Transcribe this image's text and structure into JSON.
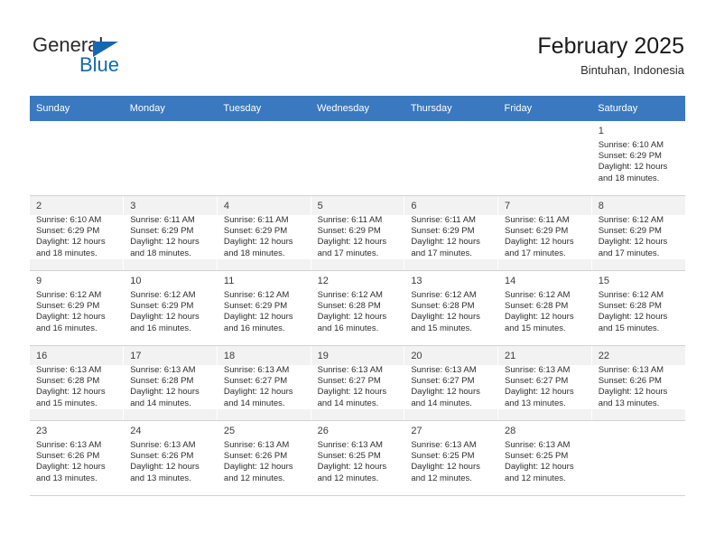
{
  "brand": {
    "line1": "General",
    "line2": "Blue",
    "triangle_color": "#1268b3",
    "icon": "triangle-icon"
  },
  "header": {
    "title": "February 2025",
    "subtitle": "Bintuhan, Indonesia"
  },
  "theme": {
    "header_row_bg": "#3a78bf",
    "header_row_text": "#ffffff",
    "band_shaded_bg": "#f2f2f2",
    "cell_bg": "#ffffff",
    "grid_line": "#d2d2d2"
  },
  "weekdays": [
    "Sunday",
    "Monday",
    "Tuesday",
    "Wednesday",
    "Thursday",
    "Friday",
    "Saturday"
  ],
  "labels": {
    "sunrise": "Sunrise:",
    "sunset": "Sunset:",
    "daylight": "Daylight:"
  },
  "weeks": [
    {
      "shaded": false,
      "days": [
        {
          "num": "",
          "lines": []
        },
        {
          "num": "",
          "lines": []
        },
        {
          "num": "",
          "lines": []
        },
        {
          "num": "",
          "lines": []
        },
        {
          "num": "",
          "lines": []
        },
        {
          "num": "",
          "lines": []
        },
        {
          "num": "1",
          "lines": [
            "Sunrise: 6:10 AM",
            "Sunset: 6:29 PM",
            "Daylight: 12 hours",
            "and 18 minutes."
          ]
        }
      ]
    },
    {
      "shaded": true,
      "days": [
        {
          "num": "2",
          "lines": [
            "Sunrise: 6:10 AM",
            "Sunset: 6:29 PM",
            "Daylight: 12 hours",
            "and 18 minutes."
          ]
        },
        {
          "num": "3",
          "lines": [
            "Sunrise: 6:11 AM",
            "Sunset: 6:29 PM",
            "Daylight: 12 hours",
            "and 18 minutes."
          ]
        },
        {
          "num": "4",
          "lines": [
            "Sunrise: 6:11 AM",
            "Sunset: 6:29 PM",
            "Daylight: 12 hours",
            "and 18 minutes."
          ]
        },
        {
          "num": "5",
          "lines": [
            "Sunrise: 6:11 AM",
            "Sunset: 6:29 PM",
            "Daylight: 12 hours",
            "and 17 minutes."
          ]
        },
        {
          "num": "6",
          "lines": [
            "Sunrise: 6:11 AM",
            "Sunset: 6:29 PM",
            "Daylight: 12 hours",
            "and 17 minutes."
          ]
        },
        {
          "num": "7",
          "lines": [
            "Sunrise: 6:11 AM",
            "Sunset: 6:29 PM",
            "Daylight: 12 hours",
            "and 17 minutes."
          ]
        },
        {
          "num": "8",
          "lines": [
            "Sunrise: 6:12 AM",
            "Sunset: 6:29 PM",
            "Daylight: 12 hours",
            "and 17 minutes."
          ]
        }
      ]
    },
    {
      "shaded": false,
      "days": [
        {
          "num": "9",
          "lines": [
            "Sunrise: 6:12 AM",
            "Sunset: 6:29 PM",
            "Daylight: 12 hours",
            "and 16 minutes."
          ]
        },
        {
          "num": "10",
          "lines": [
            "Sunrise: 6:12 AM",
            "Sunset: 6:29 PM",
            "Daylight: 12 hours",
            "and 16 minutes."
          ]
        },
        {
          "num": "11",
          "lines": [
            "Sunrise: 6:12 AM",
            "Sunset: 6:29 PM",
            "Daylight: 12 hours",
            "and 16 minutes."
          ]
        },
        {
          "num": "12",
          "lines": [
            "Sunrise: 6:12 AM",
            "Sunset: 6:28 PM",
            "Daylight: 12 hours",
            "and 16 minutes."
          ]
        },
        {
          "num": "13",
          "lines": [
            "Sunrise: 6:12 AM",
            "Sunset: 6:28 PM",
            "Daylight: 12 hours",
            "and 15 minutes."
          ]
        },
        {
          "num": "14",
          "lines": [
            "Sunrise: 6:12 AM",
            "Sunset: 6:28 PM",
            "Daylight: 12 hours",
            "and 15 minutes."
          ]
        },
        {
          "num": "15",
          "lines": [
            "Sunrise: 6:12 AM",
            "Sunset: 6:28 PM",
            "Daylight: 12 hours",
            "and 15 minutes."
          ]
        }
      ]
    },
    {
      "shaded": true,
      "days": [
        {
          "num": "16",
          "lines": [
            "Sunrise: 6:13 AM",
            "Sunset: 6:28 PM",
            "Daylight: 12 hours",
            "and 15 minutes."
          ]
        },
        {
          "num": "17",
          "lines": [
            "Sunrise: 6:13 AM",
            "Sunset: 6:28 PM",
            "Daylight: 12 hours",
            "and 14 minutes."
          ]
        },
        {
          "num": "18",
          "lines": [
            "Sunrise: 6:13 AM",
            "Sunset: 6:27 PM",
            "Daylight: 12 hours",
            "and 14 minutes."
          ]
        },
        {
          "num": "19",
          "lines": [
            "Sunrise: 6:13 AM",
            "Sunset: 6:27 PM",
            "Daylight: 12 hours",
            "and 14 minutes."
          ]
        },
        {
          "num": "20",
          "lines": [
            "Sunrise: 6:13 AM",
            "Sunset: 6:27 PM",
            "Daylight: 12 hours",
            "and 14 minutes."
          ]
        },
        {
          "num": "21",
          "lines": [
            "Sunrise: 6:13 AM",
            "Sunset: 6:27 PM",
            "Daylight: 12 hours",
            "and 13 minutes."
          ]
        },
        {
          "num": "22",
          "lines": [
            "Sunrise: 6:13 AM",
            "Sunset: 6:26 PM",
            "Daylight: 12 hours",
            "and 13 minutes."
          ]
        }
      ]
    },
    {
      "shaded": false,
      "days": [
        {
          "num": "23",
          "lines": [
            "Sunrise: 6:13 AM",
            "Sunset: 6:26 PM",
            "Daylight: 12 hours",
            "and 13 minutes."
          ]
        },
        {
          "num": "24",
          "lines": [
            "Sunrise: 6:13 AM",
            "Sunset: 6:26 PM",
            "Daylight: 12 hours",
            "and 13 minutes."
          ]
        },
        {
          "num": "25",
          "lines": [
            "Sunrise: 6:13 AM",
            "Sunset: 6:26 PM",
            "Daylight: 12 hours",
            "and 12 minutes."
          ]
        },
        {
          "num": "26",
          "lines": [
            "Sunrise: 6:13 AM",
            "Sunset: 6:25 PM",
            "Daylight: 12 hours",
            "and 12 minutes."
          ]
        },
        {
          "num": "27",
          "lines": [
            "Sunrise: 6:13 AM",
            "Sunset: 6:25 PM",
            "Daylight: 12 hours",
            "and 12 minutes."
          ]
        },
        {
          "num": "28",
          "lines": [
            "Sunrise: 6:13 AM",
            "Sunset: 6:25 PM",
            "Daylight: 12 hours",
            "and 12 minutes."
          ]
        },
        {
          "num": "",
          "lines": []
        }
      ]
    }
  ]
}
